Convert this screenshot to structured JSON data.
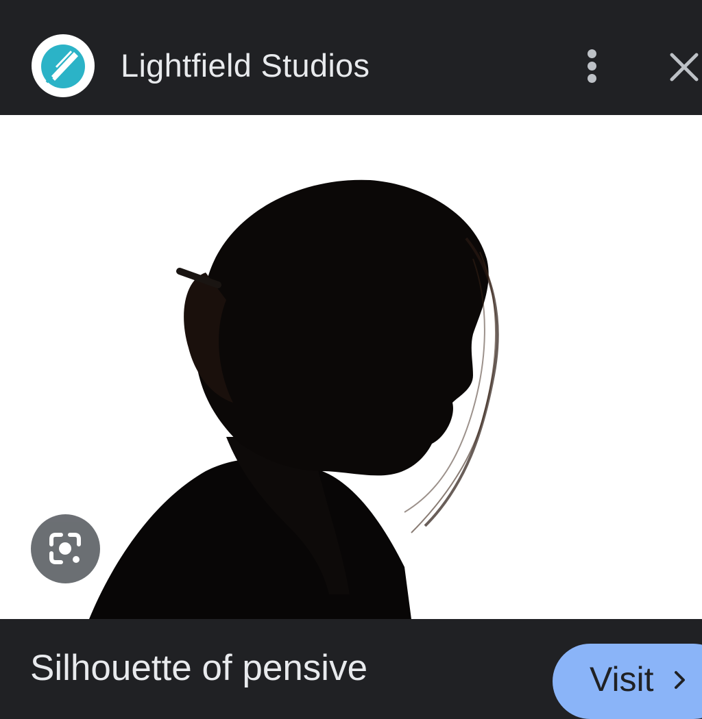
{
  "header": {
    "site_name": "Lightfield Studios",
    "logo_icon": "lightfield-logo-icon",
    "more_icon": "more-vert-icon",
    "close_icon": "close-icon"
  },
  "image": {
    "subject": "silhouette-photo"
  },
  "lens_icon": "google-lens-icon",
  "footer": {
    "caption": "Silhouette of pensive",
    "visit_label": "Visit",
    "visit_icon": "chevron-right-icon"
  },
  "colors": {
    "background": "#202124",
    "text": "#e8eaed",
    "accent": "#8ab4f8",
    "logo": "#2bb3c7"
  }
}
